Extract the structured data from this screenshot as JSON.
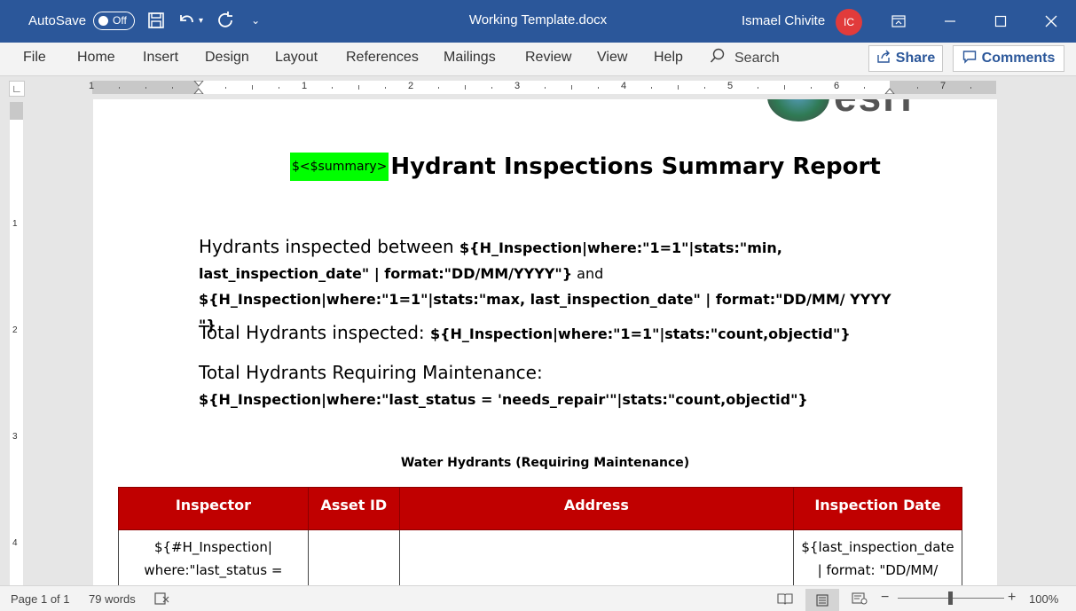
{
  "titlebar": {
    "autosave_label": "AutoSave",
    "autosave_state": "Off",
    "doc_title": "Working Template.docx",
    "user_name": "Ismael Chivite",
    "user_initials": "IC"
  },
  "ribbon": {
    "tabs": [
      "File",
      "Home",
      "Insert",
      "Design",
      "Layout",
      "References",
      "Mailings",
      "Review",
      "View",
      "Help"
    ],
    "search_label": "Search",
    "share_label": "Share",
    "comments_label": "Comments"
  },
  "ruler": {
    "h_numbers": [
      "1",
      "1",
      "2",
      "3",
      "4",
      "5",
      "6",
      "7"
    ],
    "v_numbers": [
      "1",
      "2",
      "3",
      "4"
    ]
  },
  "document": {
    "highlight_tag": "$<$summary>",
    "title": "Hydrant Inspections Summary Report",
    "p1_intro": "Hydrants inspected between ",
    "p1_code1": "${H_Inspection|where:\"1=1\"|stats:\"min, last_inspection_date\" | format:\"DD/MM/YYYY\"}",
    "p1_and": " and ",
    "p1_code2": "${H_Inspection|where:\"1=1\"|stats:\"max, last_inspection_date\" | format:\"DD/MM/ YYYY \"}",
    "p2_label": "Total Hydrants inspected: ",
    "p2_code": "${H_Inspection|where:\"1=1\"|stats:\"count,objectid\"}",
    "p3_label": "Total Hydrants Requiring Maintenance: ",
    "p3_code": "${H_Inspection|where:\"last_status = 'needs_repair'\"|stats:\"count,objectid\"}",
    "table_caption": "Water Hydrants (Requiring Maintenance)",
    "table_headers": [
      "Inspector",
      "Asset ID",
      "Address",
      "Inspection Date"
    ],
    "row1": {
      "inspector": "${#H_Inspection| where:\"last_status =",
      "asset_id": "",
      "address": "",
      "date": "${last_inspection_date | format: \"DD/MM/ YYYY\"}${/}"
    }
  },
  "statusbar": {
    "page": "Page 1 of 1",
    "words": "79 words",
    "zoom": "100%"
  },
  "colors": {
    "title_bar": "#2b579a",
    "table_header": "#c00000",
    "highlight": "#00ff00",
    "avatar": "#e13b3b"
  }
}
